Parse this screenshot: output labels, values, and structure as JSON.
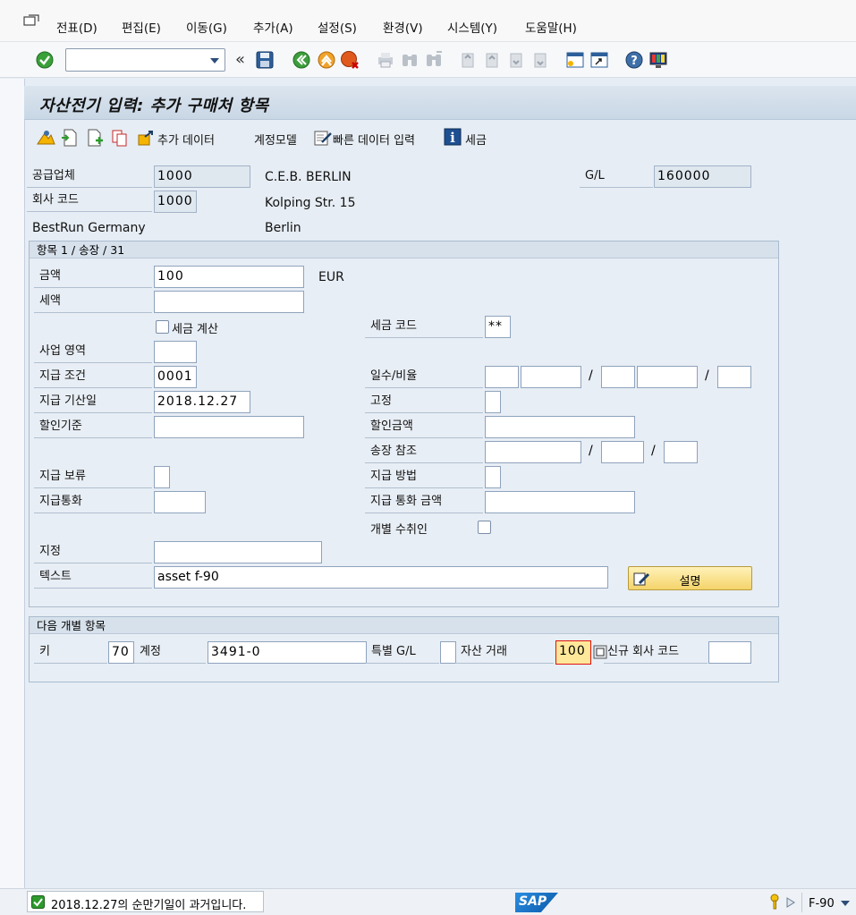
{
  "menu": {
    "items": [
      "전표(D)",
      "편집(E)",
      "이동(G)",
      "추가(A)",
      "설정(S)",
      "환경(V)",
      "시스템(Y)",
      "도움말(H)"
    ]
  },
  "toolbar": {
    "command_value": "",
    "back_glyph": "«",
    "icons": [
      "enter-icon",
      "save-icon",
      "back-icon",
      "exit-icon",
      "cancel-icon",
      "print-icon",
      "find-icon",
      "find-next-icon",
      "first-page-icon",
      "prev-page-icon",
      "next-page-icon",
      "last-page-icon",
      "create-session-icon",
      "shortcut-icon",
      "help-icon",
      "layout-icon"
    ]
  },
  "title": "자산전기 입력: 추가 구매처 항목",
  "app_toolbar": {
    "additional_data": "추가 데이터",
    "account_model": "계정모델",
    "fast_data_entry": "빠른 데이터 입력",
    "taxes": "세금"
  },
  "header": {
    "vendor_label": "공급업체",
    "vendor_value": "1000",
    "vendor_name": "C.E.B. BERLIN",
    "gl_label": "G/L",
    "gl_value": "160000",
    "company_code_label": "회사 코드",
    "company_code_value": "1000",
    "street": "Kolping Str. 15",
    "company_name": "BestRun Germany",
    "city": "Berlin"
  },
  "item_group": {
    "title": "항목 1 / 송장 / 31",
    "amount_label": "금액",
    "amount_value": "100",
    "currency": "EUR",
    "tax_amount_label": "세액",
    "tax_amount_value": "",
    "calc_tax_label": "세금 계산",
    "tax_code_label": "세금 코드",
    "tax_code_value": "**",
    "business_area_label": "사업 영역",
    "payment_terms_label": "지급 조건",
    "payment_terms_value": "0001",
    "days_percent_label": "일수/비율",
    "baseline_date_label": "지급 기산일",
    "baseline_date_value": "2018.12.27",
    "fixed_label": "고정",
    "discount_base_label": "할인기준",
    "discount_amount_label": "할인금액",
    "invoice_ref_label": "송장 참조",
    "payment_block_label": "지급 보류",
    "payment_method_label": "지급 방법",
    "payment_currency_label": "지급통화",
    "payment_currency_amount_label": "지급 통화 금액",
    "individual_payee_label": "개별 수취인",
    "assignment_label": "지정",
    "assignment_value": "",
    "text_label": "텍스트",
    "text_value": "asset f-90",
    "explain_button": "설명"
  },
  "next_item_group": {
    "title": "다음 개별 항목",
    "key_label": "키",
    "key_value": "70",
    "account_label": "계정",
    "account_value": "3491-0",
    "special_gl_label": "특별 G/L",
    "special_gl_value": "",
    "asset_trans_label": "자산 거래",
    "asset_trans_value": "100",
    "new_company_code_label": "신규 회사 코드",
    "new_company_code_value": ""
  },
  "status": {
    "message": "2018.12.27의 순만기일이 과거입니다.",
    "brand": "SAP",
    "transaction": "F-90"
  },
  "colors": {
    "accent_blue": "#2d4d78",
    "status_green": "#2e9a2e",
    "button_yellow": "#f4d36a",
    "sap_blue": "#1a73c8"
  }
}
